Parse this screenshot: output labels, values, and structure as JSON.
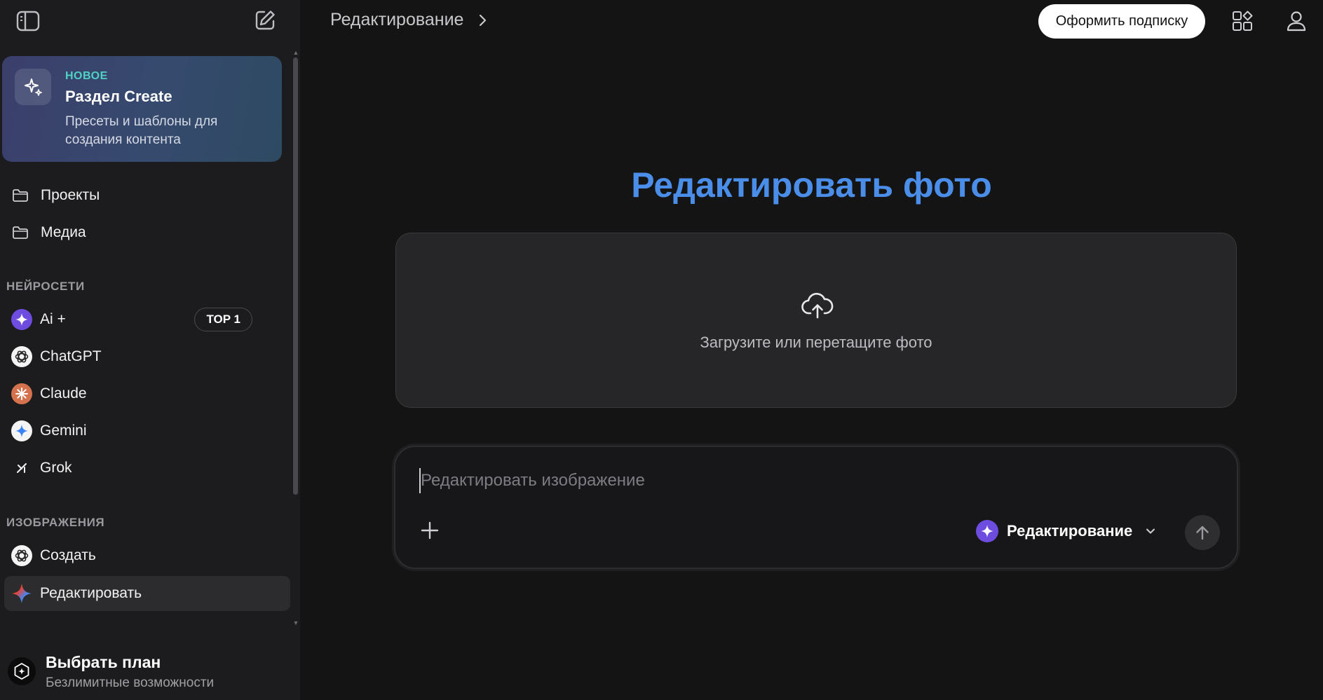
{
  "header": {
    "breadcrumb": "Редактирование",
    "subscribe_label": "Оформить подписку"
  },
  "sidebar": {
    "promo": {
      "badge": "НОВОЕ",
      "badge_color": "#4fd1c5",
      "title": "Раздел Create",
      "description": "Пресеты и шаблоны для создания контента"
    },
    "folders": [
      {
        "label": "Проекты",
        "icon": "folder-icon"
      },
      {
        "label": "Медиа",
        "icon": "folder-icon"
      }
    ],
    "sections": {
      "neural": {
        "title": "НЕЙРОСЕТИ",
        "items": [
          {
            "label": "Ai +",
            "icon": "ai-plus-icon",
            "badge": "TOP 1"
          },
          {
            "label": "ChatGPT",
            "icon": "chatgpt-icon"
          },
          {
            "label": "Claude",
            "icon": "claude-icon"
          },
          {
            "label": "Gemini",
            "icon": "gemini-icon"
          },
          {
            "label": "Grok",
            "icon": "grok-icon"
          }
        ]
      },
      "images": {
        "title": "ИЗОБРАЖЕНИЯ",
        "items": [
          {
            "label": "Создать",
            "icon": "chatgpt-icon"
          },
          {
            "label": "Редактировать",
            "icon": "gemini-color-icon",
            "active": true
          }
        ]
      }
    },
    "plan": {
      "title": "Выбрать план",
      "subtitle": "Безлимитные возможности"
    }
  },
  "main": {
    "title": "Редактировать фото",
    "title_color": "#4a8eea",
    "upload_text": "Загрузите или перетащите фото",
    "composer": {
      "placeholder": "Редактировать изображение",
      "mode_label": "Редактирование"
    }
  }
}
